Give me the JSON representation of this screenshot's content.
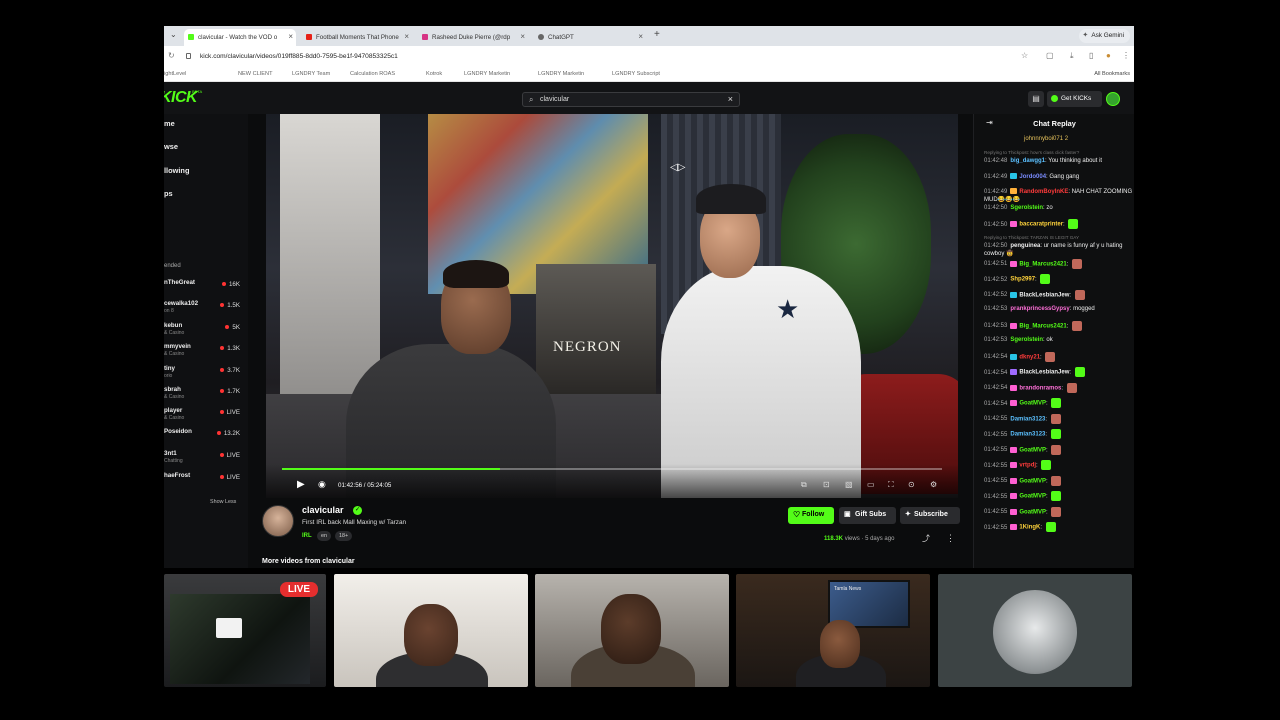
{
  "browser": {
    "tabs": [
      {
        "label": "clavicular - Watch the VOD o",
        "favicon_color": "#53fc18",
        "active": true
      },
      {
        "label": "Football Moments That Phone",
        "favicon_color": "#e62117",
        "active": false
      },
      {
        "label": "Rasheed Duke Pierre (@rdp",
        "favicon_color": "#d63384",
        "active": false
      },
      {
        "label": "ChatGPT",
        "favicon_color": "#666666",
        "active": false
      }
    ],
    "gemini_label": "Ask Gemini",
    "url": "kick.com/clavicular/videos/019ff885-8dd0-7595-be1f-9470853325c1",
    "bookmarks": [
      "ightLevel",
      "NEW CLIENT",
      "LGNDRY Team",
      "Calculation ROAS",
      "Kotrok",
      "LGNDRY Marketin",
      "LGNDRY Marketin",
      "LGNDRY Subscript"
    ],
    "all_bookmarks": "All Bookmarks"
  },
  "kick": {
    "logo": "KICK",
    "beta": "BETA",
    "search": {
      "value": "clavicular"
    },
    "get_kicks": "Get KICKs",
    "nav": [
      "me",
      "wse",
      "llowing",
      "ps"
    ],
    "recommended_header": "ended",
    "channels": [
      {
        "name": "nTheGreat",
        "sub": "",
        "count": "16K"
      },
      {
        "name": "cewalka102",
        "sub": "on 8",
        "count": "1.5K"
      },
      {
        "name": "kebun",
        "sub": "& Casino",
        "count": "5K"
      },
      {
        "name": "mmyvein",
        "sub": "& Casino",
        "count": "1.3K"
      },
      {
        "name": "tiny",
        "sub": "orio",
        "count": "3.7K"
      },
      {
        "name": "sbrah",
        "sub": "& Casino",
        "count": "1.7K"
      },
      {
        "name": "player",
        "sub": "& Casino",
        "count": "LIVE"
      },
      {
        "name": "Poseidon",
        "sub": "",
        "count": "13.2K"
      },
      {
        "name": "3nt1",
        "sub": "Chatting",
        "count": "LIVE"
      },
      {
        "name": "haeFrost",
        "sub": "",
        "count": "LIVE"
      }
    ],
    "show_less": "Show Less",
    "player": {
      "time": "01:42:56 / 05:24:05",
      "progress": 0.33
    },
    "video": {
      "channel": "clavicular",
      "title": "First IRL back Mall Maxing w/ Tarzan",
      "category": "IRL",
      "tags": [
        "en",
        "18+"
      ],
      "follow": "Follow",
      "gift_subs": "Gift Subs",
      "subscribe": "Subscribe",
      "views_count": "118.3K",
      "views_label": "views",
      "age": "5 days ago",
      "more_videos": "More videos from clavicular"
    },
    "sign_text": "NEGRON",
    "chat": {
      "title": "Chat Replay",
      "pinned": "johnnnyboi071",
      "pinned_count": "2",
      "messages": [
        {
          "reply": "Replying to Thickpost: how's class click faster?"
        },
        {
          "time": "01:42:48",
          "user": "big_dawgg1",
          "color": "#5bc0ff",
          "text": "You thinking about it",
          "badge": ""
        },
        {
          "time": "01:42:49",
          "user": "Jordo004",
          "color": "#7a8cff",
          "text": "Gang gang",
          "badge": "#28c4e6"
        },
        {
          "time": "01:42:49",
          "user": "RandomBoyInKE",
          "color": "#ff3b3b",
          "text": "NAH CHAT ZOOMING MUD😂😂😂",
          "badge": "#ffb13b"
        },
        {
          "time": "01:42:50",
          "user": "Sgerolstein",
          "color": "#53fc18",
          "text": "zo",
          "badge": ""
        },
        {
          "time": "01:42:50",
          "user": "baccaratprinter",
          "color": "#ffd33b",
          "text": "",
          "badge": "#ff5fd2"
        },
        {
          "reply": "Replying to Thickpost: TARZAN IS LEGIT GAY"
        },
        {
          "time": "01:42:50",
          "user": "penguinea",
          "color": "#eeeeee",
          "text": "ur name is funny af y u hating cowboy 🤠",
          "badge": ""
        },
        {
          "time": "01:42:51",
          "user": "Big_Marcus2421",
          "color": "#53fc18",
          "text": "",
          "badge": "#ff5fd2"
        },
        {
          "time": "01:42:52",
          "user": "Shp2997",
          "color": "#ffd33b",
          "text": "",
          "badge": ""
        },
        {
          "time": "01:42:52",
          "user": "BlackLesbianJew",
          "color": "#eeeeee",
          "text": "",
          "badge": "#28c4e6"
        },
        {
          "time": "01:42:53",
          "user": "prankprincessGypsy",
          "color": "#ff6fd8",
          "text": "mogged",
          "badge": ""
        },
        {
          "time": "01:42:53",
          "user": "Big_Marcus2421",
          "color": "#53fc18",
          "text": "",
          "badge": "#ff5fd2"
        },
        {
          "time": "01:42:53",
          "user": "Sgerolstein",
          "color": "#53fc18",
          "text": "ok",
          "badge": ""
        },
        {
          "time": "01:42:54",
          "user": "dkny21",
          "color": "#ff3b3b",
          "text": "",
          "badge": "#28c4e6"
        },
        {
          "time": "01:42:54",
          "user": "BlackLesbianJew",
          "color": "#eeeeee",
          "text": "",
          "badge": "#a06bff"
        },
        {
          "time": "01:42:54",
          "user": "brandonramos",
          "color": "#ff6fd8",
          "text": "",
          "badge": "#ff5fd2"
        },
        {
          "time": "01:42:54",
          "user": "GoatMVP",
          "color": "#53fc18",
          "text": "",
          "badge": "#ff5fd2"
        },
        {
          "time": "01:42:55",
          "user": "Damian3123",
          "color": "#5bc0ff",
          "text": "",
          "badge": ""
        },
        {
          "time": "01:42:55",
          "user": "Damian3123",
          "color": "#5bc0ff",
          "text": "",
          "badge": ""
        },
        {
          "time": "01:42:55",
          "user": "GoatMVP",
          "color": "#53fc18",
          "text": "",
          "badge": "#ff5fd2"
        },
        {
          "time": "01:42:55",
          "user": "vrtpdj",
          "color": "#ff3b3b",
          "text": "",
          "badge": "#ff5fd2"
        },
        {
          "time": "01:42:55",
          "user": "GoatMVP",
          "color": "#53fc18",
          "text": "",
          "badge": "#ff5fd2"
        },
        {
          "time": "01:42:55",
          "user": "GoatMVP",
          "color": "#53fc18",
          "text": "",
          "badge": "#ff5fd2"
        },
        {
          "time": "01:42:55",
          "user": "GoatMVP",
          "color": "#53fc18",
          "text": "",
          "badge": "#ff5fd2"
        },
        {
          "time": "01:42:55",
          "user": "1KingK",
          "color": "#ffd33b",
          "text": "",
          "badge": "#ff5fd2"
        }
      ]
    }
  },
  "webcams": {
    "live_badge": "LIVE",
    "tv_text": "Tamla News"
  },
  "colors": {
    "kick_green": "#53fc18",
    "live_red": "#e52e2e"
  }
}
